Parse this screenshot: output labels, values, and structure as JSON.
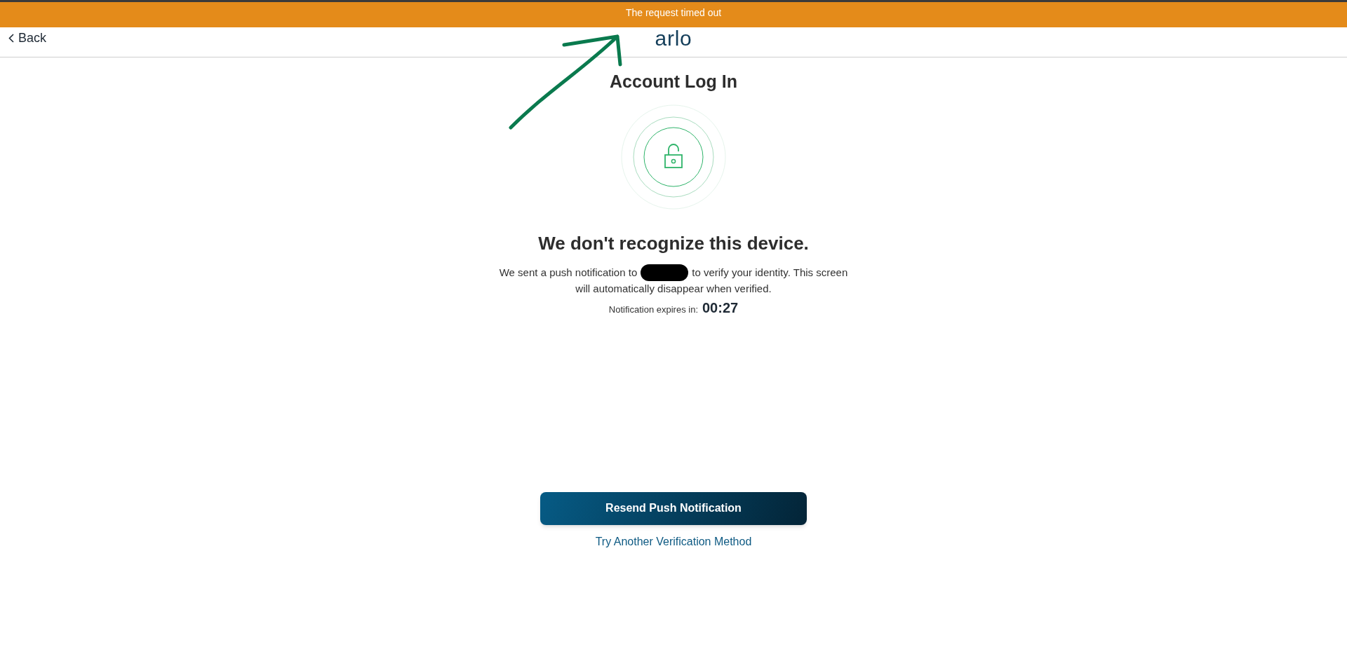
{
  "alert": {
    "message": "The request timed out"
  },
  "header": {
    "back": "Back",
    "logo": "arlo"
  },
  "title": "Account Log In",
  "heading": "We don't recognize this device.",
  "message": {
    "before": "We sent a push notification to",
    "after": "to verify your identity. This screen",
    "line2": "will automatically disappear when verified."
  },
  "expiry": {
    "label": "Notification expires in:",
    "time": "00:27"
  },
  "buttons": {
    "primary": "Resend Push Notification",
    "link": "Try Another Verification Method"
  }
}
